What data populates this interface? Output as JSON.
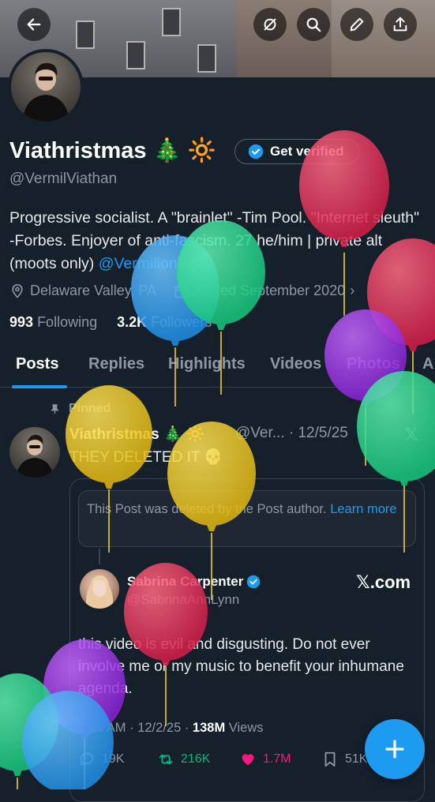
{
  "header": {
    "back_icon": "arrow-left-icon",
    "actions": [
      "hide-icon",
      "search-icon",
      "edit-icon",
      "share-icon"
    ]
  },
  "profile": {
    "display_name": "Viathristmas 🎄 🔆",
    "verify_label": "Get verified",
    "handle": "@VermilViathan",
    "bio_text": "Progressive socialist. A \"brainlet\" -Tim Pool. \"Internet sleuth\" -Forbes. Enjoyer of anti-fascism. 27 he/him | private alt (moots only) ",
    "bio_link": "@VermilionViath",
    "location": "Delaware Valley, PA",
    "joined": "Joined September 2020",
    "following_count": "993",
    "following_label": "Following",
    "followers_count": "3.2K",
    "followers_label": "Followers"
  },
  "tabs": [
    "Posts",
    "Replies",
    "Highlights",
    "Videos",
    "Photos",
    "A"
  ],
  "pinned_post": {
    "pinned_label": "Pinned",
    "author": "Viathristmas 🎄 🔆",
    "handle_date": "@Ver... · 12/5/25",
    "text": "THEY DELETED IT 💀",
    "deleted_notice": "This Post was deleted by the Post author. ",
    "deleted_link": "Learn more",
    "quoted": {
      "author": "Sabrina Carpenter",
      "handle": "@SabrinaAnnLynn",
      "source": "𝕏.com",
      "text": "this video is evil and disgusting. Do not ever involve me or my music to benefit your inhumane agenda.",
      "time": "1:25 AM · 12/2/25 · ",
      "views_count": "138M",
      "views_label": " Views",
      "replies": "19K",
      "reposts": "216K",
      "likes": "1.7M",
      "bookmarks": "51K"
    }
  },
  "colors": {
    "background": "#15202b",
    "accent": "#1d9bf0",
    "repost": "#00ba7c",
    "like": "#f91880"
  }
}
